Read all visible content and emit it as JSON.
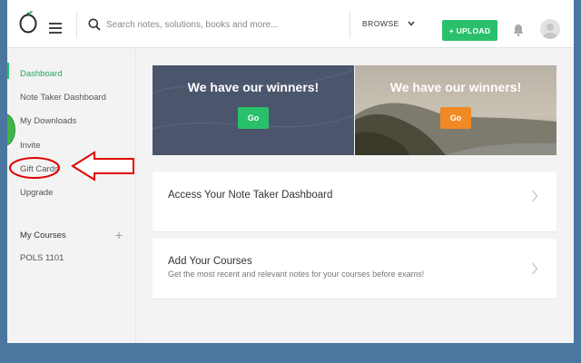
{
  "header": {
    "search_placeholder": "Search notes, solutions, books and more...",
    "browse_label": "BROWSE",
    "upload_label": "+ UPLOAD"
  },
  "sidebar": {
    "items": [
      {
        "label": "Dashboard",
        "active": true
      },
      {
        "label": "Note Taker Dashboard",
        "active": false
      },
      {
        "label": "My Downloads",
        "active": false
      },
      {
        "label": "Invite",
        "active": false
      },
      {
        "label": "Gift Cards",
        "active": false
      },
      {
        "label": "Upgrade",
        "active": false
      }
    ],
    "courses_heading": "My Courses",
    "courses_add_icon": "plus-icon",
    "courses": [
      "POLS 1101"
    ]
  },
  "banners": [
    {
      "title": "We have our winners!",
      "button_label": "Go",
      "button_color": "#2ac06b",
      "background": "#4b566c"
    },
    {
      "title": "We have our winners!",
      "button_label": "Go",
      "button_color": "#f08a24",
      "background": "coastline-photo"
    }
  ],
  "cards": [
    {
      "title": "Access Your Note Taker Dashboard",
      "subtitle": "",
      "icon": "chevron-right-icon"
    },
    {
      "title": "Add Your Courses",
      "subtitle": "Get the most recent and relevant notes for your courses before exams!",
      "icon": "chevron-right-icon"
    }
  ],
  "colors": {
    "accent": "#2ac06b",
    "annotation": "#e00000",
    "page_background": "#4a76a0"
  },
  "annotation": {
    "type": "red arrow and ellipse highlighting Gift Cards"
  }
}
